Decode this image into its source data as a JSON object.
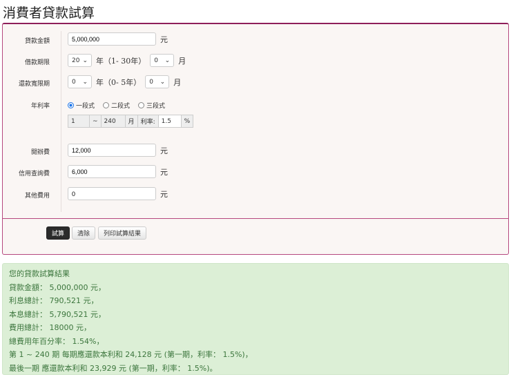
{
  "title": "消費者貸款試算",
  "form": {
    "amount": {
      "label": "貸款金額",
      "value": "5,000,000",
      "unit": "元"
    },
    "term": {
      "label": "借款期限",
      "years": "20",
      "years_note": "年（1- 30年）",
      "months": "0",
      "months_unit": "月"
    },
    "grace": {
      "label": "還款寬限期",
      "years": "0",
      "years_note": "年（0- 5年）",
      "months": "0",
      "months_unit": "月"
    },
    "rate": {
      "label": "年利率",
      "options": [
        "一段式",
        "二段式",
        "三段式"
      ],
      "selected": "一段式",
      "segment": {
        "from": "1",
        "sep": "~",
        "to": "240",
        "month_unit": "月",
        "rate_label": "利率:",
        "rate": "1.5",
        "pct": "%"
      }
    },
    "open_fee": {
      "label": "開辦費",
      "value": "12,000",
      "unit": "元"
    },
    "credit_fee": {
      "label": "信用查詢費",
      "value": "6,000",
      "unit": "元"
    },
    "other_fee": {
      "label": "其他費用",
      "value": "0",
      "unit": "元"
    }
  },
  "buttons": {
    "calc": "試算",
    "clear": "清除",
    "print": "列印試算結果"
  },
  "result": {
    "lines": [
      "您的貸款試算結果",
      "貸款金額： 5,000,000 元，",
      "利息總計： 790,521 元，",
      "本息總計： 5,790,521 元，",
      "費用總計： 18000 元，",
      "總費用年百分率： 1.54%，",
      "第 1 ~ 240 期 每期應還款本利和 24,128 元 (第一期，利率： 1.5%)，",
      "最後一期 應還款本利和 23,929 元 (第一期，利率： 1.5%)。"
    ]
  }
}
